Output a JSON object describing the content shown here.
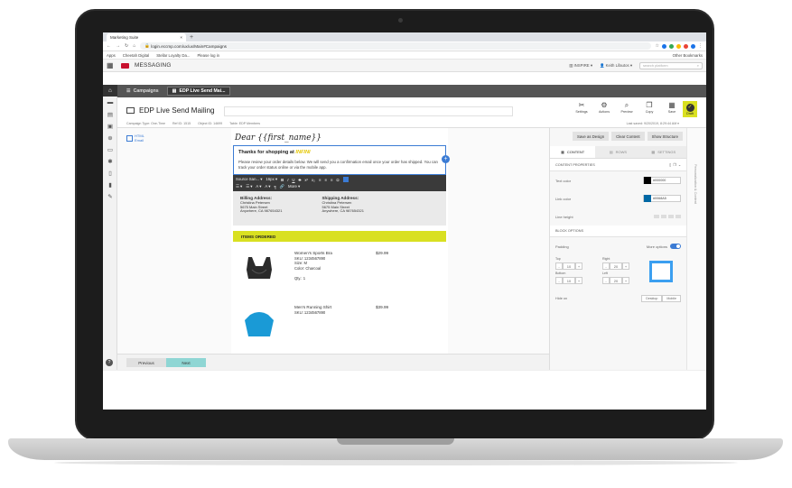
{
  "browser": {
    "tab_title": "Marketing Suite",
    "tab_close": "×",
    "new_tab": "+",
    "url": "login.eccmp.com/ux/ux/Main#Campaigns",
    "bookmarks": [
      "Apps",
      "Cheetah Digital",
      "Stellar Loyalty Da...",
      "Please log in"
    ],
    "other_bookmarks": "Other Bookmarks"
  },
  "app": {
    "title": "MESSAGING",
    "user_menu": "INSPIRE",
    "user_name": "Keith Lifautos",
    "search_placeholder": "search platform"
  },
  "breadcrumbs": [
    {
      "label": "Campaigns"
    },
    {
      "label": "EDP Live Send Mai..."
    }
  ],
  "mailing": {
    "title": "EDP Live Send Mailing",
    "campaign_type": "Campaign Type: One-Time",
    "ref_id": "Ref ID: 1515",
    "object_id": "Object ID: 14699",
    "table": "Table: EDP Members",
    "last_saved": "Last saved: 9/20/2019, 8:29:44 AM",
    "tools": [
      {
        "label": "Settings",
        "icon": "settings-icon"
      },
      {
        "label": "Actions",
        "icon": "actions-icon"
      },
      {
        "label": "Preview",
        "icon": "preview-icon"
      },
      {
        "label": "Copy",
        "icon": "copy-icon"
      },
      {
        "label": "Save",
        "icon": "save-icon"
      }
    ],
    "status": "Draft"
  },
  "editor": {
    "badge": "HTML",
    "badge_sub": "Email",
    "greeting": "Dear {{first_name}}",
    "text_heading": "Thanks for shopping at ",
    "text_heading_highlight": "INFINI",
    "text_body": "Please review your order details below. We will send you a confirmation email once your order has shipped. You can track your order status online or via the mobile app.",
    "toolbar_font": "Source San...",
    "toolbar_size": "16px",
    "toolbar_more": "More",
    "billing_title": "Billing Address:",
    "billing_lines": [
      "Christina Petersen",
      "5675 Main Street",
      "Anywhere, CA 987654321"
    ],
    "shipping_title": "Shipping Address:",
    "shipping_lines": [
      "Christina Petersen",
      "5675 Main Street",
      "Anywhere, CA 987654321"
    ],
    "items_heading": "ITEMS ORDERED",
    "products": [
      {
        "name": "Women's Sports Bra",
        "sku": "SKU: 1234567890",
        "size": "Size: M",
        "color": "Color: Charcoal",
        "qty": "Qty.: 1",
        "price": "$29.99"
      },
      {
        "name": "Men's Running Shirt",
        "sku": "SKU: 1234567890",
        "price": "$39.99"
      }
    ]
  },
  "nav": {
    "prev": "Previous",
    "next": "Next"
  },
  "panel": {
    "buttons": [
      "Save as Design",
      "Clear Content",
      "Show Structure"
    ],
    "tabs": [
      "CONTENT",
      "ROWS",
      "SETTINGS"
    ],
    "content_properties": "CONTENT PROPERTIES",
    "text_color_label": "Text color",
    "text_color_value": "#000000",
    "link_color_label": "Link color",
    "link_color_value": "#0068A5",
    "line_height_label": "Line height",
    "block_options": "BLOCK OPTIONS",
    "padding_label": "Padding",
    "more_options": "More options",
    "top_label": "Top",
    "top_value": "10",
    "right_label": "Right",
    "right_value": "20",
    "bottom_label": "Bottom",
    "bottom_value": "10",
    "left_label": "Left",
    "left_value": "20",
    "hide_on_label": "Hide on",
    "hide_desktop": "Desktop",
    "hide_mobile": "Mobile"
  },
  "vertical_tab": "Personalization & Content",
  "colors": {
    "accent": "#d9e021",
    "blue": "#3b7bd4",
    "brand": "#c8102e"
  }
}
